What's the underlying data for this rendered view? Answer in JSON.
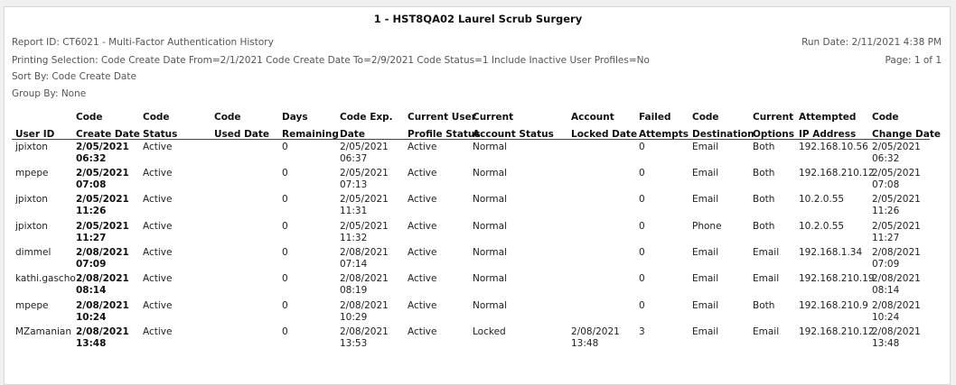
{
  "report": {
    "title": "1 - HST8QA02 Laurel Scrub Surgery",
    "report_id": "Report ID: CT6021 - Multi-Factor Authentication History",
    "run_date": "Run Date: 2/11/2021 4:38 PM",
    "printing_selection": "Printing Selection: Code Create Date From=2/1/2021 Code Create Date To=2/9/2021 Code Status=1 Include Inactive User Profiles=No",
    "page": "Page: 1 of 1",
    "sort_by": "Sort By: Code Create Date",
    "group_by": "Group By: None"
  },
  "columns": [
    {
      "l1": "",
      "l2": "User ID"
    },
    {
      "l1": "Code",
      "l2": "Create Date"
    },
    {
      "l1": "Code",
      "l2": "Status"
    },
    {
      "l1": "Code",
      "l2": "Used Date"
    },
    {
      "l1": "Days",
      "l2": "Remaining"
    },
    {
      "l1": "Code Exp.",
      "l2": "Date"
    },
    {
      "l1": "Current User",
      "l2": "Profile Status"
    },
    {
      "l1": "Current",
      "l2": "Account Status"
    },
    {
      "l1": "Account",
      "l2": "Locked Date"
    },
    {
      "l1": "Failed",
      "l2": "Attempts"
    },
    {
      "l1": "Code",
      "l2": "Destination"
    },
    {
      "l1": "Current",
      "l2": "Options"
    },
    {
      "l1": "Attempted",
      "l2": "IP Address"
    },
    {
      "l1": "Code",
      "l2": "Change Date"
    }
  ],
  "rows": [
    {
      "user": "jpixton",
      "create_d": "2/05/2021",
      "create_t": "06:32",
      "status": "Active",
      "used": "",
      "days": "0",
      "exp_d": "2/05/2021",
      "exp_t": "06:37",
      "profile": "Active",
      "account": "Normal",
      "locked_d": "",
      "locked_t": "",
      "failed": "0",
      "dest": "Email",
      "options": "Both",
      "ip": "192.168.10.56",
      "change_d": "2/05/2021",
      "change_t": "06:32"
    },
    {
      "user": "mpepe",
      "create_d": "2/05/2021",
      "create_t": "07:08",
      "status": "Active",
      "used": "",
      "days": "0",
      "exp_d": "2/05/2021",
      "exp_t": "07:13",
      "profile": "Active",
      "account": "Normal",
      "locked_d": "",
      "locked_t": "",
      "failed": "0",
      "dest": "Email",
      "options": "Both",
      "ip": "192.168.210.12",
      "change_d": "2/05/2021",
      "change_t": "07:08"
    },
    {
      "user": "jpixton",
      "create_d": "2/05/2021",
      "create_t": "11:26",
      "status": "Active",
      "used": "",
      "days": "0",
      "exp_d": "2/05/2021",
      "exp_t": "11:31",
      "profile": "Active",
      "account": "Normal",
      "locked_d": "",
      "locked_t": "",
      "failed": "0",
      "dest": "Email",
      "options": "Both",
      "ip": "10.2.0.55",
      "change_d": "2/05/2021",
      "change_t": "11:26"
    },
    {
      "user": "jpixton",
      "create_d": "2/05/2021",
      "create_t": "11:27",
      "status": "Active",
      "used": "",
      "days": "0",
      "exp_d": "2/05/2021",
      "exp_t": "11:32",
      "profile": "Active",
      "account": "Normal",
      "locked_d": "",
      "locked_t": "",
      "failed": "0",
      "dest": "Phone",
      "options": "Both",
      "ip": "10.2.0.55",
      "change_d": "2/05/2021",
      "change_t": "11:27"
    },
    {
      "user": "dimmel",
      "create_d": "2/08/2021",
      "create_t": "07:09",
      "status": "Active",
      "used": "",
      "days": "0",
      "exp_d": "2/08/2021",
      "exp_t": "07:14",
      "profile": "Active",
      "account": "Normal",
      "locked_d": "",
      "locked_t": "",
      "failed": "0",
      "dest": "Email",
      "options": "Email",
      "ip": "192.168.1.34",
      "change_d": "2/08/2021",
      "change_t": "07:09"
    },
    {
      "user": "kathi.gascho",
      "create_d": "2/08/2021",
      "create_t": "08:14",
      "status": "Active",
      "used": "",
      "days": "0",
      "exp_d": "2/08/2021",
      "exp_t": "08:19",
      "profile": "Active",
      "account": "Normal",
      "locked_d": "",
      "locked_t": "",
      "failed": "0",
      "dest": "Email",
      "options": "Email",
      "ip": "192.168.210.19",
      "change_d": "2/08/2021",
      "change_t": "08:14"
    },
    {
      "user": "mpepe",
      "create_d": "2/08/2021",
      "create_t": "10:24",
      "status": "Active",
      "used": "",
      "days": "0",
      "exp_d": "2/08/2021",
      "exp_t": "10:29",
      "profile": "Active",
      "account": "Normal",
      "locked_d": "",
      "locked_t": "",
      "failed": "0",
      "dest": "Email",
      "options": "Both",
      "ip": "192.168.210.9",
      "change_d": "2/08/2021",
      "change_t": "10:24"
    },
    {
      "user": "MZamanian",
      "create_d": "2/08/2021",
      "create_t": "13:48",
      "status": "Active",
      "used": "",
      "days": "0",
      "exp_d": "2/08/2021",
      "exp_t": "13:53",
      "profile": "Active",
      "account": "Locked",
      "locked_d": "2/08/2021",
      "locked_t": "13:48",
      "failed": "3",
      "dest": "Email",
      "options": "Email",
      "ip": "192.168.210.12",
      "change_d": "2/08/2021",
      "change_t": "13:48"
    }
  ]
}
